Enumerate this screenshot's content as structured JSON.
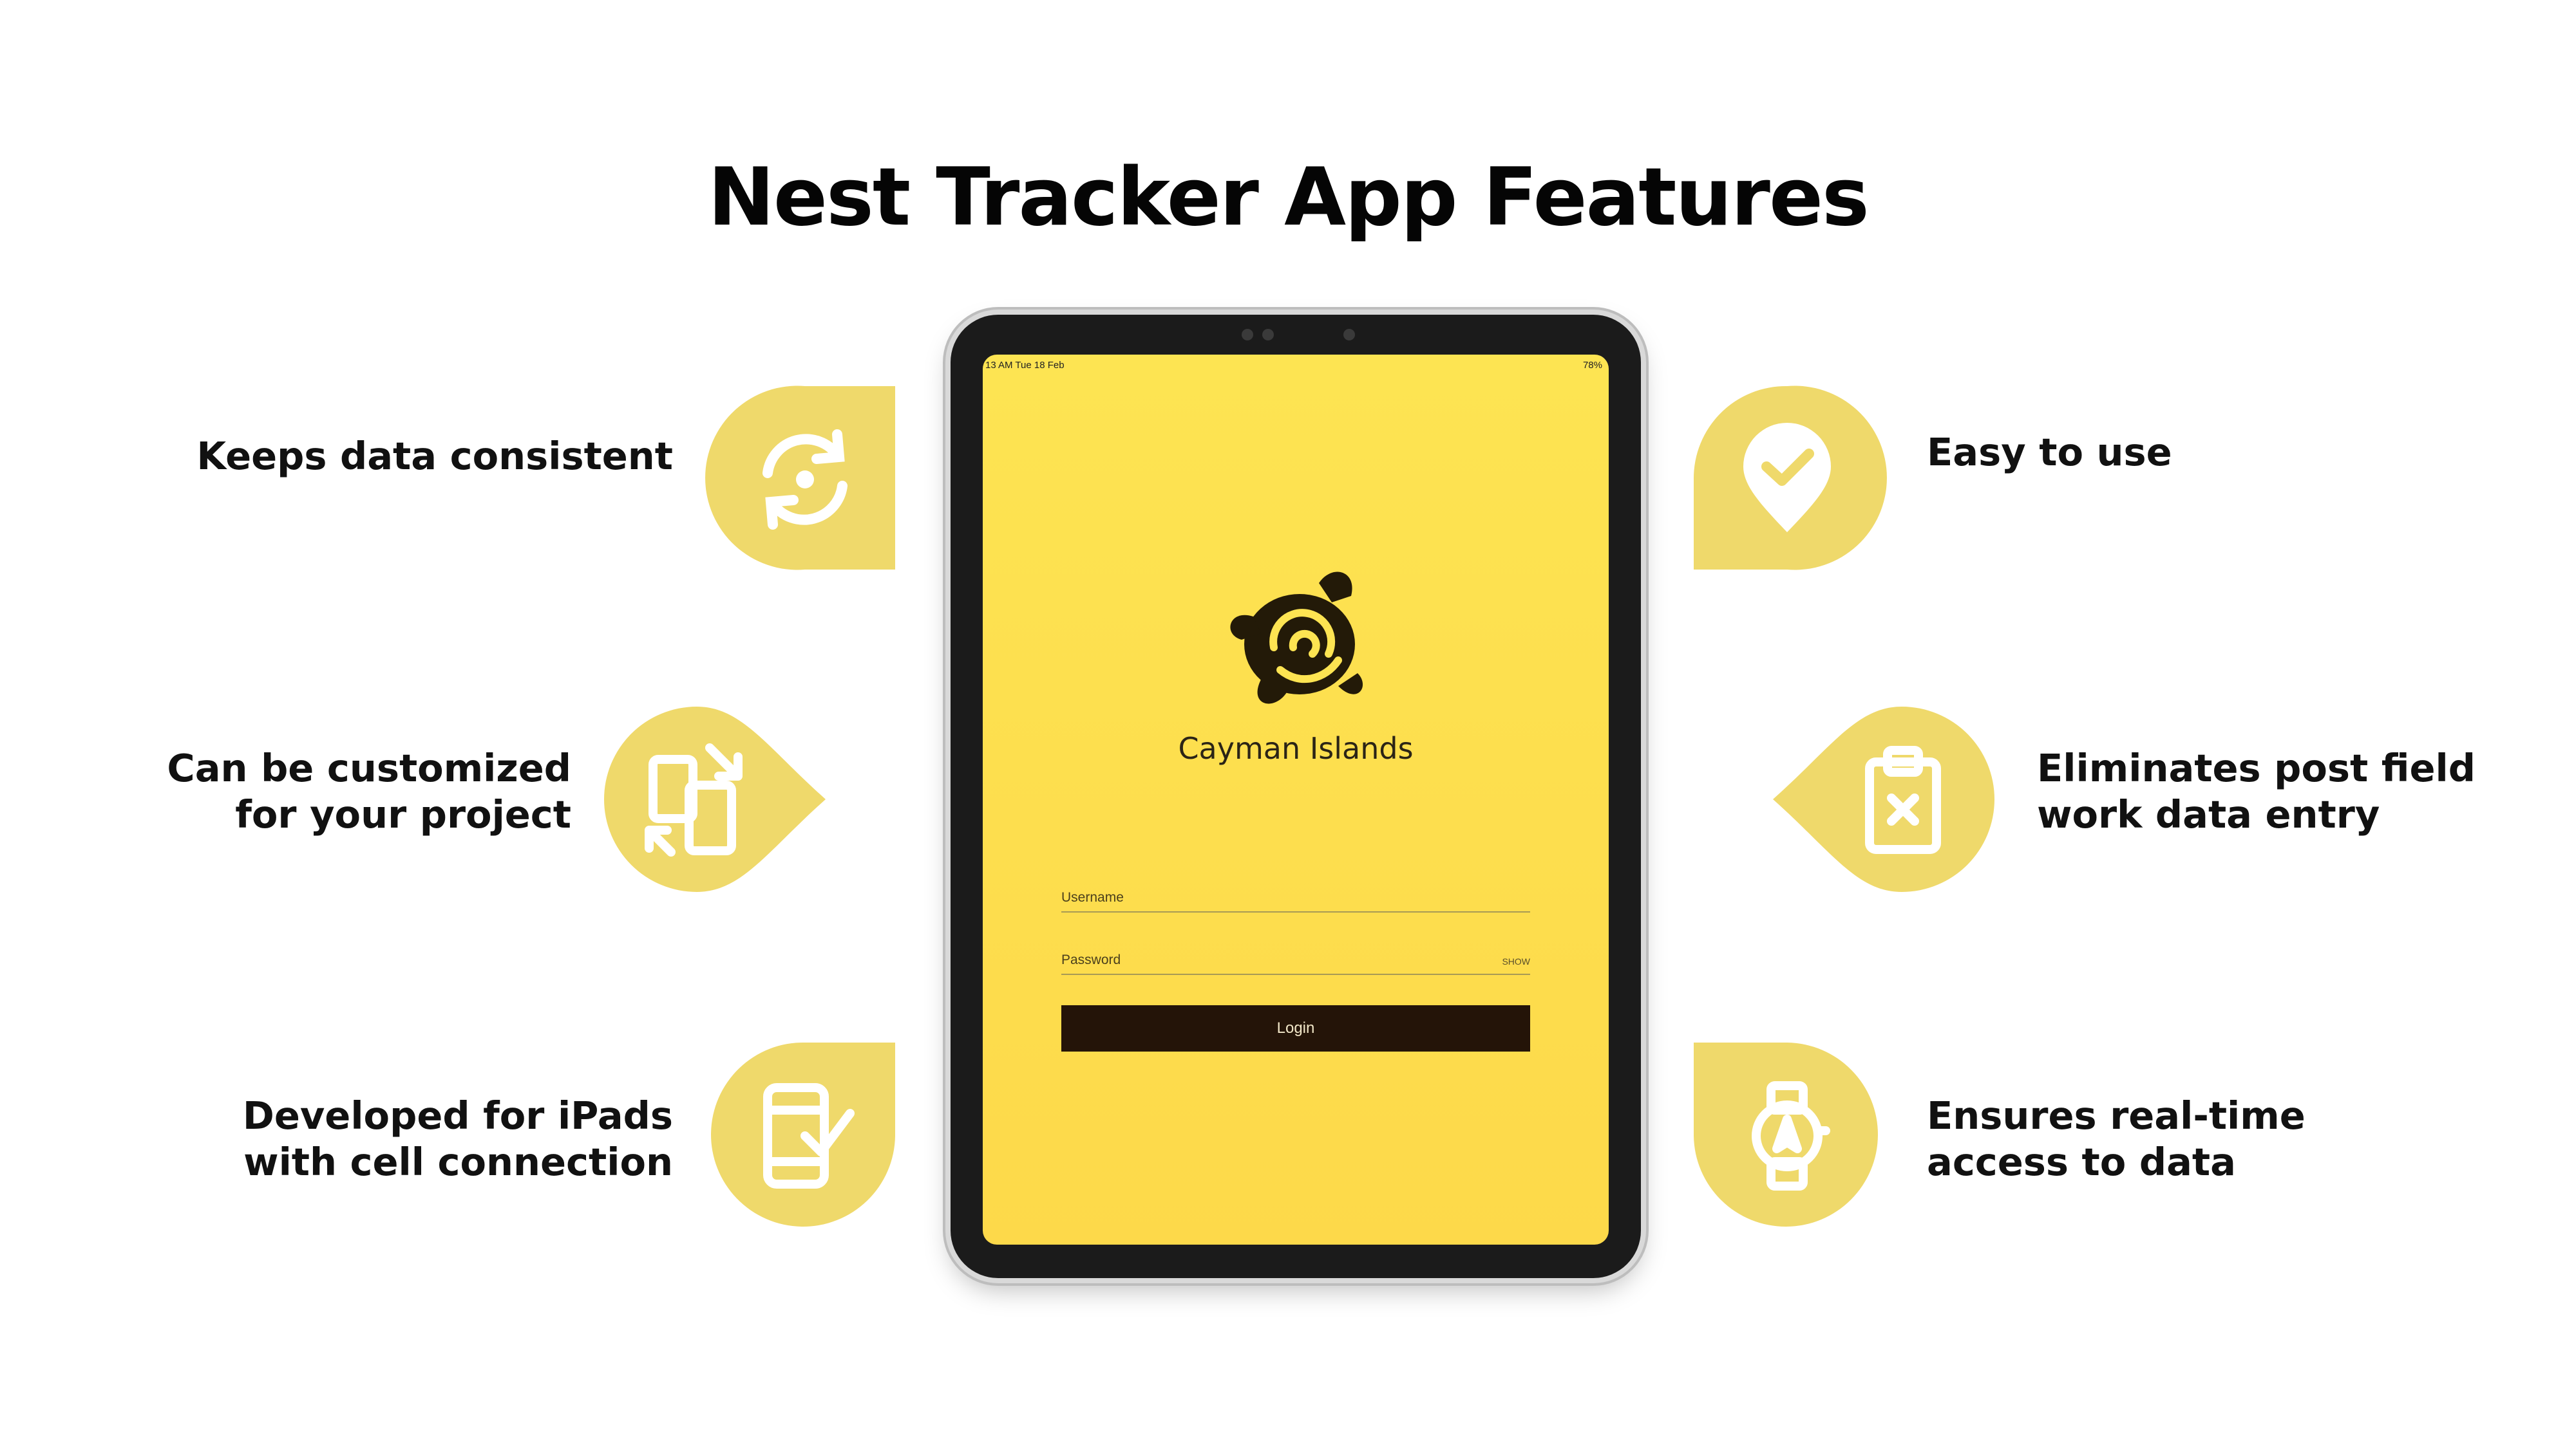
{
  "title": "Nest Tracker App Features",
  "colors": {
    "badge": "#efd96b",
    "icon": "#ffffff",
    "screen": "#fde452",
    "login_button": "#241408"
  },
  "features": [
    {
      "lines": [
        "Keeps data consistent"
      ],
      "icon": "sync-icon"
    },
    {
      "lines": [
        "Can be customized",
        "for your project"
      ],
      "icon": "resize-icon"
    },
    {
      "lines": [
        "Developed for iPads",
        "with cell connection"
      ],
      "icon": "mobile-check-icon"
    },
    {
      "lines": [
        "Easy to use"
      ],
      "icon": "pin-check-icon"
    },
    {
      "lines": [
        "Eliminates post field",
        "work data entry"
      ],
      "icon": "clipboard-x-icon"
    },
    {
      "lines": [
        "Ensures real-time",
        "access to data"
      ],
      "icon": "smartwatch-icon"
    }
  ],
  "tablet": {
    "status_time": "13 AM   Tue 18 Feb",
    "status_battery": "78%",
    "island_name": "Cayman Islands",
    "username_label": "Username",
    "password_label": "Password",
    "show_label": "SHOW",
    "login_label": "Login"
  }
}
